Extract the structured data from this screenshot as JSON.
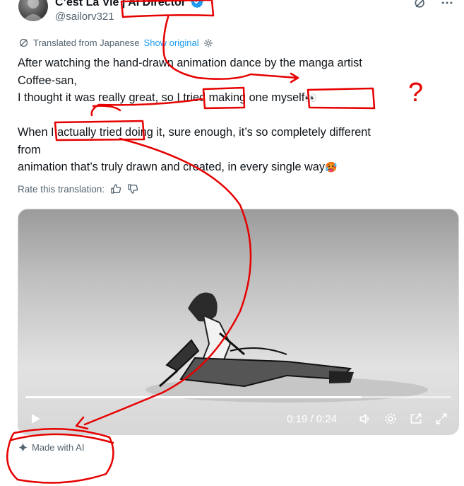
{
  "author": {
    "display_name": "C’est La Vie | AI Director",
    "handle": "@sailorv321",
    "verified": true
  },
  "translation": {
    "notice": "Translated from Japanese",
    "show_original_label": "Show original",
    "rate_label": "Rate this translation:"
  },
  "post": {
    "line1": "After watching the hand-drawn animation dance by the manga artist",
    "line2": "Coffee-san,",
    "line3": "I thought it was really great, so I tried making one myself",
    "line3_emoji": "👀",
    "line4": "When I actually tried doing it, sure enough, it’s so completely different",
    "line5": "from",
    "line6": "animation that’s truly drawn and created, in every single way",
    "line6_emoji": "🥵"
  },
  "video": {
    "time_display": "0:19 / 0:24",
    "progress_fraction": 0.79
  },
  "ai_label": "Made with AI",
  "annotation": {
    "question_mark": "?"
  },
  "icons": {
    "verified": "verified-badge-icon",
    "grok": "grok-icon",
    "more": "more-icon",
    "translate": "translate-icon",
    "settings": "gear-icon",
    "thumbs_up": "thumbs-up-icon",
    "thumbs_down": "thumbs-down-icon",
    "play": "play-icon",
    "volume": "volume-icon",
    "video_settings": "gear-icon",
    "picture_in_picture": "pip-icon",
    "fullscreen": "fullscreen-icon",
    "sparkle": "sparkle-icon"
  },
  "colors": {
    "link": "#1d9bf0",
    "secondary_text": "#536471",
    "annotation": "#e60000"
  }
}
